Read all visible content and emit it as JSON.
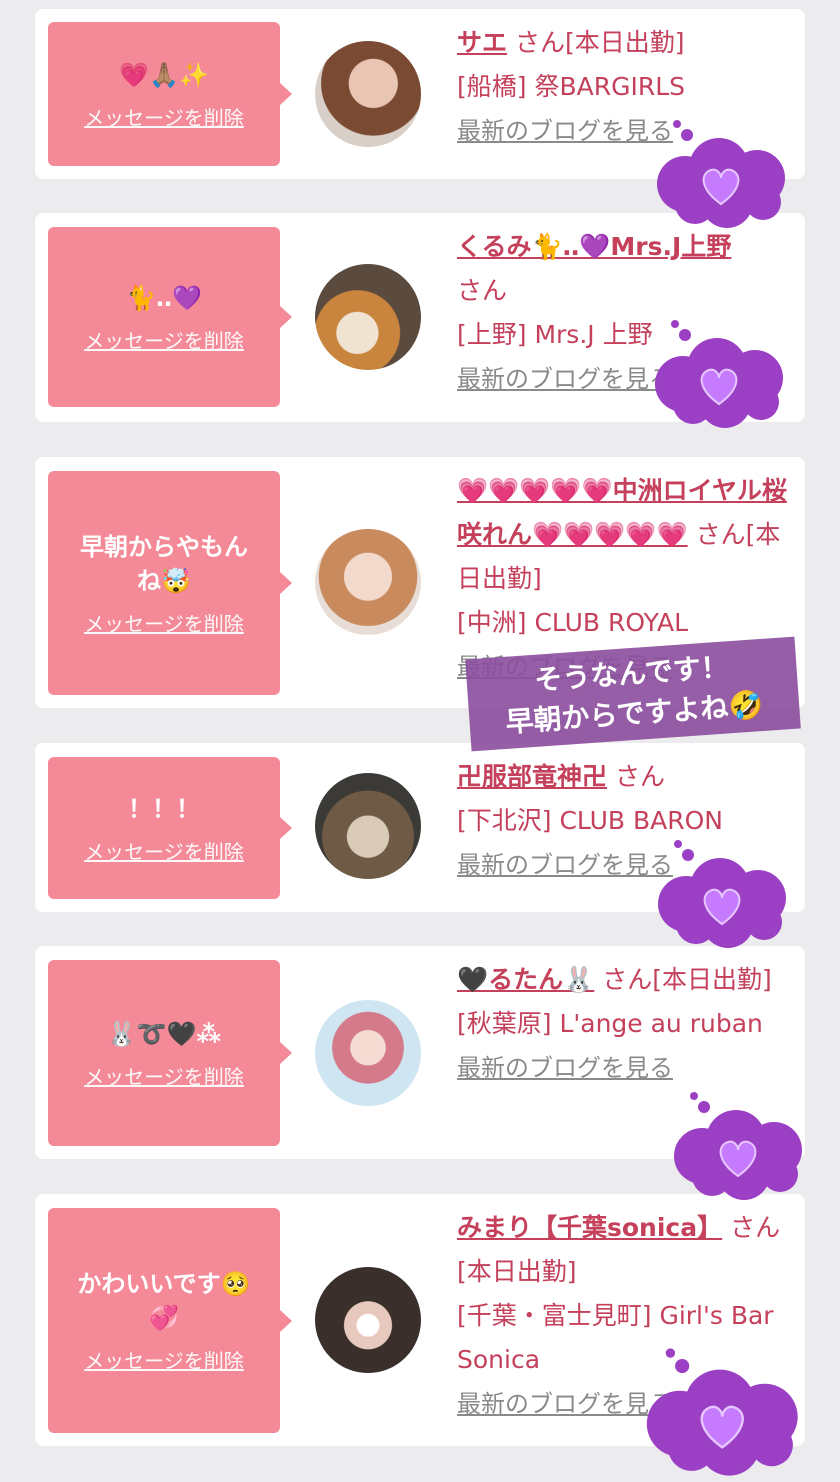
{
  "delete_label": "メッセージを削除",
  "blog_label": "最新のブログを見る",
  "colors": {
    "bubble": "#f48a98",
    "accent": "#c4405b",
    "cloud": "#9b3fc4",
    "sticker": "#8a4c9c"
  },
  "messages": [
    {
      "message": "💗🙏🏽✨",
      "name": "サエ",
      "suffix": "さん[本日出勤]",
      "shop": "[船橋] 祭BARGIRLS"
    },
    {
      "message": "🐈‥💜",
      "name": "くるみ🐈‥💜Mrs.J上野",
      "suffix": "さん",
      "shop": "[上野] Mrs.J 上野"
    },
    {
      "message": "早朝からやもんね🤯",
      "name": "💗💗💗💗💗中洲ロイヤル桜咲れん💗💗💗💗💗",
      "suffix": "さん[本日出勤]",
      "shop": "[中洲] CLUB ROYAL"
    },
    {
      "message": "！！！",
      "name": "卍服部竜神卍",
      "suffix": "さん",
      "shop": "[下北沢] CLUB BARON"
    },
    {
      "message": "🐰➰🖤⁂",
      "name": "🖤るたん🐰",
      "suffix": "さん[本日出勤]",
      "shop": "[秋葉原] L'ange au ruban"
    },
    {
      "message": "かわいいです🥺💞",
      "name": "みまり【千葉sonica】",
      "suffix": "さん[本日出勤]",
      "shop": "[千葉・富士見町] Girl's Bar Sonica"
    }
  ],
  "sticker": {
    "line1": "そうなんです！",
    "line2": "早朝からですよね🤣"
  },
  "heart_icon": "purple-heart-icon"
}
